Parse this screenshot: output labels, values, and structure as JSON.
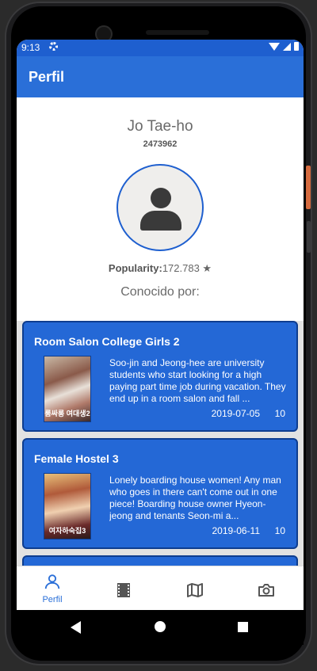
{
  "status_bar": {
    "time": "9:13",
    "icons": [
      "gear-icon",
      "wifi-icon",
      "signal-icon",
      "battery-icon"
    ]
  },
  "app_bar": {
    "title": "Perfil",
    "color": "#2a6fd8"
  },
  "profile": {
    "name": "Jo Tae-ho",
    "id": "2473962",
    "popularity_label": "Popularity:",
    "popularity_value": "172.783 ★",
    "known_for_label": "Conocido por:"
  },
  "movies": [
    {
      "title": "Room Salon College Girls 2",
      "overview": "Soo-jin and Jeong-hee are university students who start looking for a high paying part time job during vacation. They end up in a room salon and fall ...",
      "date": "2019-07-05",
      "score": "10",
      "poster_text": "룸싸롱 여대생2"
    },
    {
      "title": "Female Hostel 3",
      "overview": "Lonely boarding house women! Any man who goes in there can't come out in one piece! Boarding house owner Hyeon-jeong and tenants Seon-mi a...",
      "date": "2019-06-11",
      "score": "10",
      "poster_text": "여자하숙집3"
    }
  ],
  "bottom_nav": [
    {
      "label": "Perfil",
      "icon": "person-icon",
      "active": true
    },
    {
      "label": "",
      "icon": "film-icon",
      "active": false
    },
    {
      "label": "",
      "icon": "map-icon",
      "active": false
    },
    {
      "label": "",
      "icon": "camera-icon",
      "active": false
    }
  ],
  "colors": {
    "accent": "#2a6fd8",
    "card": "#2468d6",
    "card_border": "#0e3d8f"
  }
}
